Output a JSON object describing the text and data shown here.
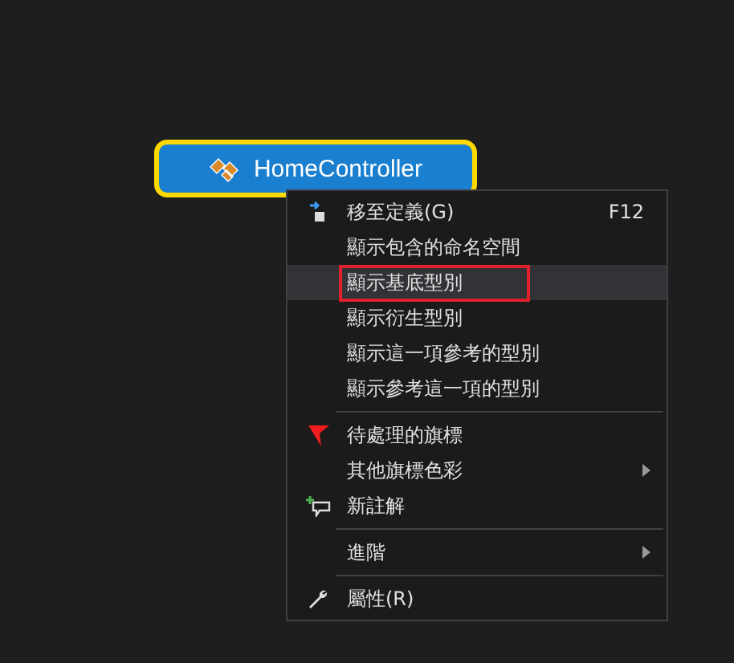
{
  "node": {
    "label": "HomeController"
  },
  "context_menu": {
    "items": [
      {
        "kind": "goto",
        "label": "移至定義(G)",
        "shortcut": "F12",
        "selected": false,
        "outlined": false,
        "submenu": false
      },
      {
        "kind": "plain",
        "label": "顯示包含的命名空間",
        "selected": false,
        "outlined": false,
        "submenu": false
      },
      {
        "kind": "plain",
        "label": "顯示基底型別",
        "selected": true,
        "outlined": true,
        "submenu": false
      },
      {
        "kind": "plain",
        "label": "顯示衍生型別",
        "selected": false,
        "outlined": false,
        "submenu": false
      },
      {
        "kind": "plain",
        "label": "顯示這一項參考的型別",
        "selected": false,
        "outlined": false,
        "submenu": false
      },
      {
        "kind": "plain",
        "label": "顯示參考這一項的型別",
        "selected": false,
        "outlined": false,
        "submenu": false
      },
      {
        "kind": "separator"
      },
      {
        "kind": "flag",
        "label": "待處理的旗標",
        "selected": false,
        "outlined": false,
        "submenu": false
      },
      {
        "kind": "plain",
        "label": "其他旗標色彩",
        "selected": false,
        "outlined": false,
        "submenu": true
      },
      {
        "kind": "comment",
        "label": "新註解",
        "selected": false,
        "outlined": false,
        "submenu": false
      },
      {
        "kind": "separator"
      },
      {
        "kind": "plain",
        "label": "進階",
        "selected": false,
        "outlined": false,
        "submenu": true
      },
      {
        "kind": "separator"
      },
      {
        "kind": "properties",
        "label": "屬性(R)",
        "selected": false,
        "outlined": false,
        "submenu": false
      }
    ]
  }
}
